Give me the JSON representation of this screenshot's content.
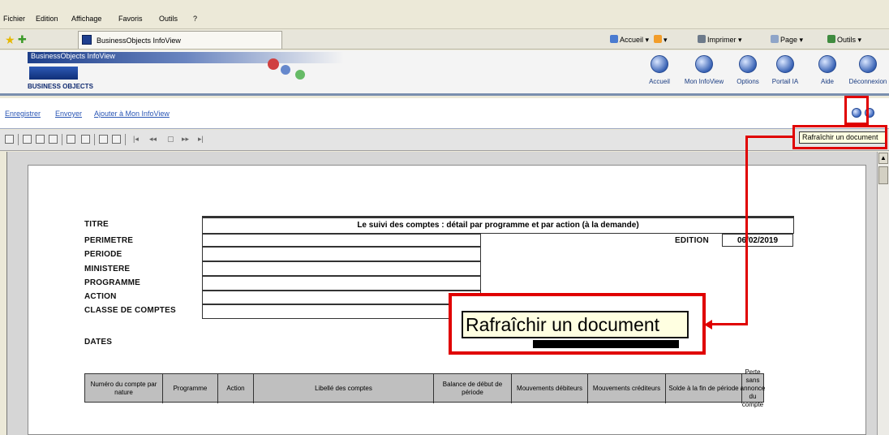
{
  "menu": [
    "Fichier",
    "Edition",
    "Affichage",
    "Favoris",
    "Outils",
    "?"
  ],
  "browser": {
    "tab_title": "BusinessObjects InfoView",
    "commands": [
      "Accueil",
      "Imprimer",
      "Page",
      "Outils"
    ]
  },
  "bo_header": {
    "banner": "BusinessObjects InfoView",
    "logo": "BUSINESS OBJECTS",
    "nav": [
      "Accueil",
      "Mon InfoView",
      "Options",
      "Portail IA",
      "Aide",
      "Déconnexion"
    ]
  },
  "actions": {
    "save": "Enregistrer",
    "send": "Envoyer",
    "add_to_infoview": "Ajouter à Mon InfoView"
  },
  "tooltip_small": "Rafraîchir un document",
  "tooltip_large": "Rafraîchir un document",
  "report": {
    "labels": {
      "titre": "TITRE",
      "perimetre": "PERIMETRE",
      "periode": "PERIODE",
      "ministere": "MINISTERE",
      "programme": "PROGRAMME",
      "action": "ACTION",
      "classe": "CLASSE DE COMPTES",
      "dates": "DATES",
      "edition": "EDITION"
    },
    "title_value": "Le suivi des comptes : détail par programme et par action (à la demande)",
    "edition_date": "06/02/2019",
    "columns": [
      "Numéro du compte par nature",
      "Programme",
      "Action",
      "Libellé des comptes",
      "Balance de début de période",
      "Mouvements débiteurs",
      "Mouvements créditeurs",
      "Solde à la fin de période",
      "Perte sans annonce du compte"
    ]
  },
  "colors": {
    "highlight_red": "#e00000",
    "tooltip_bg": "#ffffe1",
    "header_blue": "#1e3f8a"
  }
}
